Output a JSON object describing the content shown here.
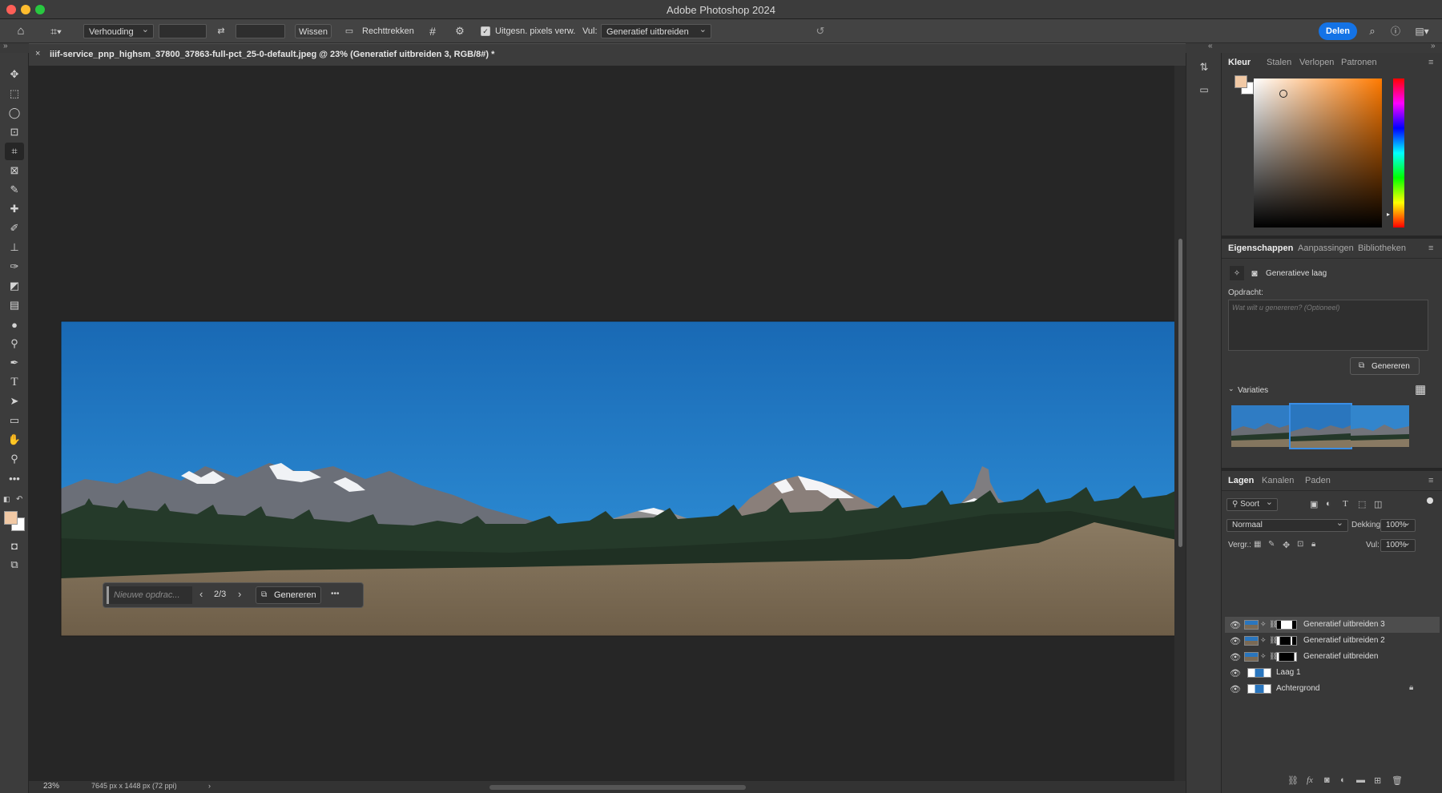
{
  "app": {
    "title": "Adobe Photoshop 2024"
  },
  "options_bar": {
    "ratio": "Verhouding",
    "clear": "Wissen",
    "straighten": "Rechttrekken",
    "delete_pixels": "Uitgesn. pixels verw.",
    "fill_label": "Vul:",
    "fill_value": "Generatief uitbreiden",
    "share": "Delen"
  },
  "document": {
    "tab_title": "iiif-service_pnp_highsm_37800_37863-full-pct_25-0-default.jpeg @ 23% (Generatief uitbreiden 3, RGB/8#) *",
    "zoom": "23%",
    "info": "7645 px x 1448 px (72 ppi)"
  },
  "contextual_taskbar": {
    "prompt_placeholder": "Nieuwe opdrac...",
    "counter": "2/3",
    "generate": "Genereren",
    "more": "•••"
  },
  "color_panel": {
    "tabs": [
      "Kleur",
      "Stalen",
      "Verlopen",
      "Patronen"
    ],
    "foreground": "#f1c9a5",
    "background": "#ffffff",
    "hue_color": "#ff7a00"
  },
  "properties_panel": {
    "tabs": [
      "Eigenschappen",
      "Aanpassingen",
      "Bibliotheken"
    ],
    "layer_type": "Generatieve laag",
    "prompt_label": "Opdracht:",
    "prompt_placeholder": "Wat wilt u genereren? (Optioneel)",
    "generate": "Genereren",
    "variations_label": "Variaties",
    "selected_variation": 2
  },
  "layers_panel": {
    "tabs": [
      "Lagen",
      "Kanalen",
      "Paden"
    ],
    "filter": "Soort",
    "blend_mode": "Normaal",
    "opacity_label": "Dekking:",
    "opacity": "100%",
    "lock_label": "Vergr.:",
    "fill_label": "Vul:",
    "fill": "100%",
    "layers": [
      {
        "name": "Generatief uitbreiden 3",
        "selected": true
      },
      {
        "name": "Generatief uitbreiden 2",
        "selected": false
      },
      {
        "name": "Generatief uitbreiden",
        "selected": false
      },
      {
        "name": "Laag 1",
        "selected": false
      },
      {
        "name": "Achtergrond",
        "selected": false,
        "locked": true
      }
    ]
  }
}
